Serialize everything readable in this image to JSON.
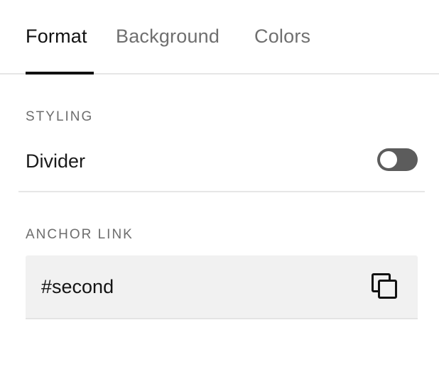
{
  "tabs": [
    {
      "label": "Format",
      "active": true
    },
    {
      "label": "Background",
      "active": false
    },
    {
      "label": "Colors",
      "active": false
    }
  ],
  "styling": {
    "section_label": "STYLING",
    "divider_label": "Divider",
    "divider_enabled": false
  },
  "anchor": {
    "section_label": "ANCHOR LINK",
    "value": "#second",
    "copy_icon": "copy-icon"
  },
  "colors": {
    "active_tab": "#111111",
    "inactive_tab": "#6f6f6f",
    "toggle_off": "#5c5c5c",
    "field_background": "#f1f1f1",
    "divider_line": "#e6e6e6"
  }
}
